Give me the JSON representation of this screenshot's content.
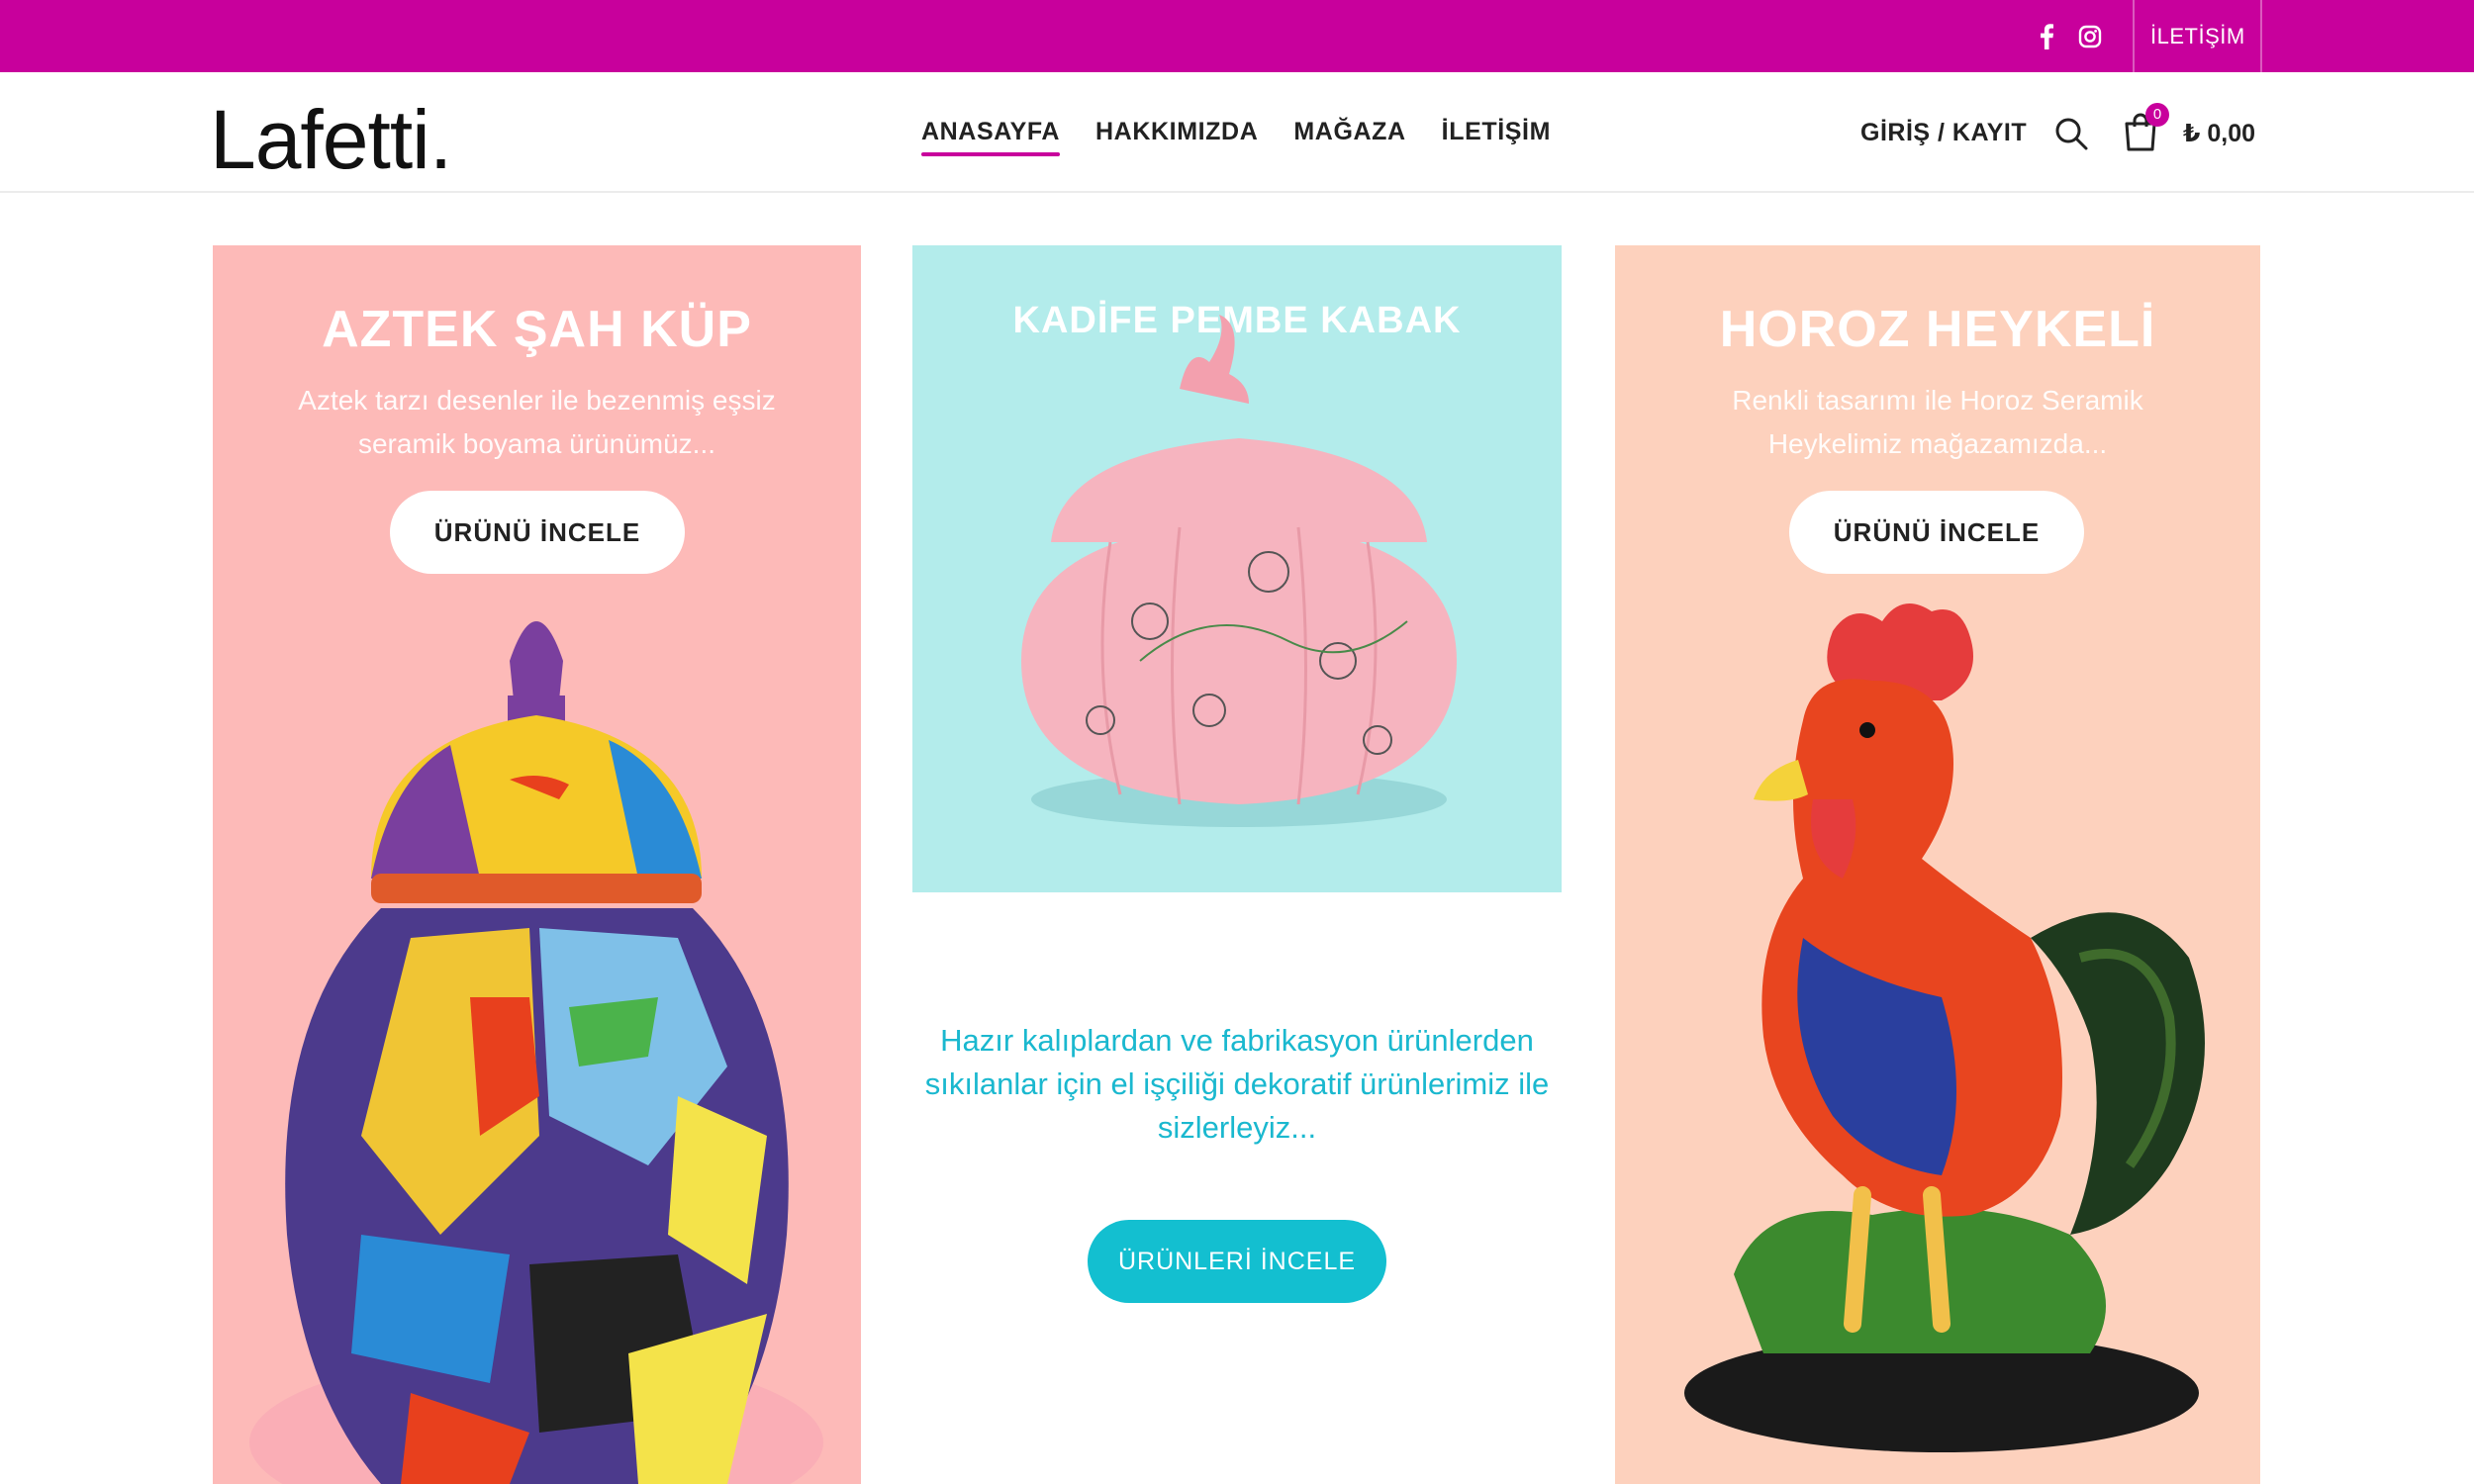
{
  "topbar": {
    "contact_label": "İLETİŞİM",
    "social": [
      "facebook-icon",
      "instagram-icon"
    ],
    "bg_color": "#c8009c"
  },
  "header": {
    "logo": "Lafetti.",
    "nav": [
      {
        "label": "ANASAYFA",
        "active": true
      },
      {
        "label": "HAKKIMIZDA",
        "active": false
      },
      {
        "label": "MAĞAZA",
        "active": false
      },
      {
        "label": "İLETİŞİM",
        "active": false
      }
    ],
    "login_label": "GİRİŞ / KAYIT",
    "cart_count": "0",
    "cart_total": "₺ 0,00"
  },
  "cards": {
    "left": {
      "title": "AZTEK ŞAH KÜP",
      "description": "Aztek tarzı desenler ile bezenmiş eşsiz seramik boyama ürünümüz...",
      "button": "ÜRÜNÜ İNCELE",
      "bg_color": "#fdbab8"
    },
    "middle": {
      "title": "KADİFE PEMBE KABAK",
      "bg_color": "#b3eceb"
    },
    "right": {
      "title": "HOROZ HEYKELİ",
      "description": "Renkli tasarımı ile Horoz Seramik Heykelimiz mağazamızda...",
      "button": "ÜRÜNÜ İNCELE",
      "bg_color": "#fdd1bd"
    }
  },
  "promo": {
    "text": "Hazır kalıplardan ve fabrikasyon ürünlerden sıkılanlar için el işçiliği dekoratif ürünlerimiz ile sizlerleyiz...",
    "button": "ÜRÜNLERİ İNCELE",
    "accent_color": "#13bfd0"
  }
}
